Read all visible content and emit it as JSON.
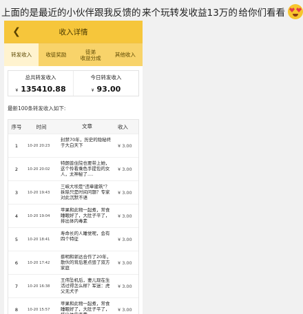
{
  "caption": {
    "part1": "上面的是最近的小伙伴跟我反馈的",
    "part2": "来个玩转发收益13万的",
    "part3": "给你们看看",
    "emoji_icon": "heart-eyes-emoji"
  },
  "header": {
    "title": "收入详情",
    "back_icon": "chevron-left-icon"
  },
  "tabs": [
    "转发收入",
    "收徒奖励",
    "徒弟\n收益分成",
    "其他收入"
  ],
  "stats": {
    "total_label": "总共转发收入",
    "total_value": "135410.88",
    "today_label": "今日转发收入",
    "today_value": "93.00",
    "currency": "¥"
  },
  "list": {
    "title": "最新100条转发收入如下:",
    "headers": {
      "no": "序号",
      "time": "时间",
      "title": "文章",
      "income": "收入"
    },
    "rows": [
      {
        "no": "1",
        "time": "10-20 20:23",
        "title": "封禁70年，历史的隐秘终于大白天下",
        "income": "¥ 3.00"
      },
      {
        "no": "2",
        "time": "10-20 20:02",
        "title": "特朗普住院也要带上她，这个怜看乘色手提包的女人，太神秘了....",
        "income": "¥ 3.00"
      },
      {
        "no": "3",
        "time": "10-20 19:43",
        "title": "三峡大坝是\"违章建筑\"？拆除只是时间问题？专家对此沉默不语",
        "income": "¥ 3.00"
      },
      {
        "no": "4",
        "time": "10-20 19:04",
        "title": "苹果和此物一起煮，常食睡眠好了，大肚子平了，排出体内毒素",
        "income": "¥ 3.00"
      },
      {
        "no": "5",
        "time": "10-20 18:41",
        "title": "寿命长的人睡觉呢，会有四个特征",
        "income": "¥ 3.00"
      },
      {
        "no": "6",
        "time": "10-20 17:42",
        "title": "蔡明和郭达合作了20年，散伙的背后差点毁了双方家庭",
        "income": "¥ 3.00"
      },
      {
        "no": "7",
        "time": "10-20 16:38",
        "title": "王伟坠机后，妻儿现在生活过得怎么样？军迷：虎父无犬子",
        "income": "¥ 3.00"
      },
      {
        "no": "8",
        "time": "10-20 15:57",
        "title": "苹果和此物一起煮，常食睡眠好了，大肚子平了，排出体内毒素",
        "income": "¥ 3.00"
      }
    ]
  }
}
